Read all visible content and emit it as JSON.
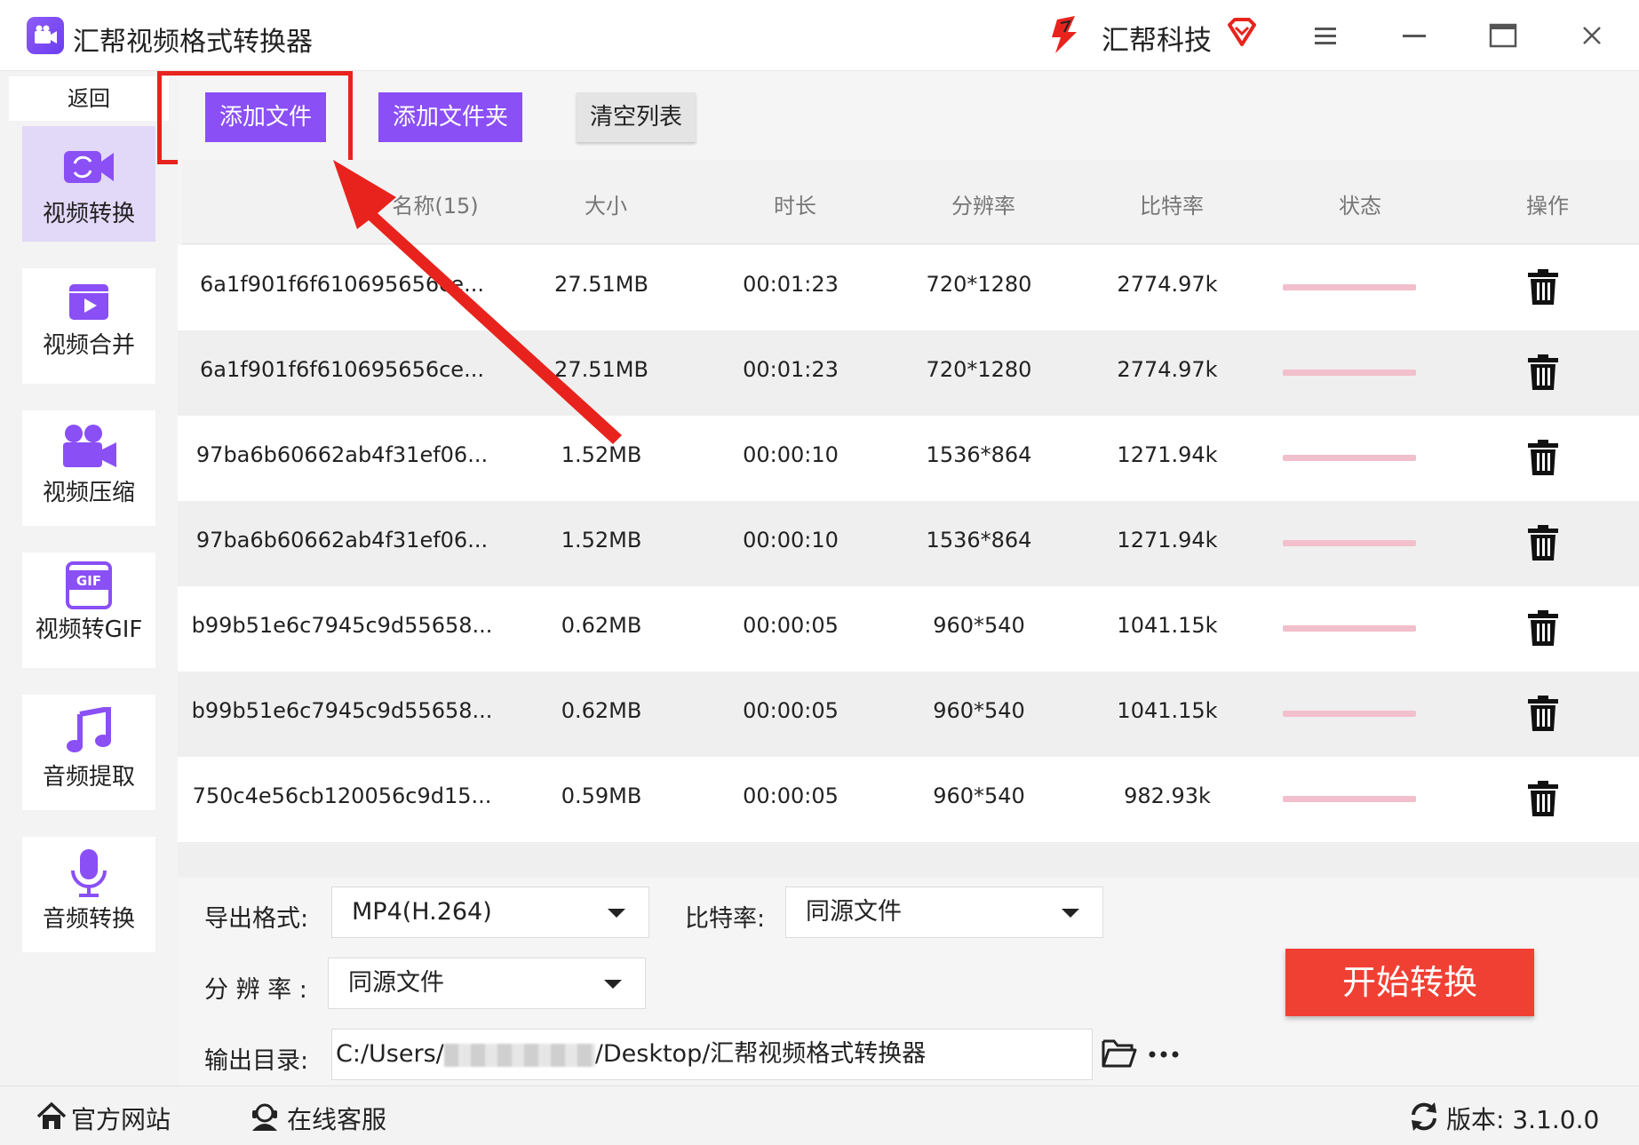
{
  "app": {
    "title": "汇帮视频格式转换器",
    "brand": "汇帮科技"
  },
  "sidebar": {
    "back": "返回",
    "items": [
      {
        "label": "视频转换",
        "icon": "video-convert-icon",
        "active": true
      },
      {
        "label": "视频合并",
        "icon": "video-merge-icon"
      },
      {
        "label": "视频压缩",
        "icon": "video-compress-icon"
      },
      {
        "label": "视频转GIF",
        "icon": "gif-icon"
      },
      {
        "label": "音频提取",
        "icon": "music-note-icon"
      },
      {
        "label": "音频转换",
        "icon": "microphone-icon"
      }
    ]
  },
  "toolbar": {
    "add_file": "添加文件",
    "add_folder": "添加文件夹",
    "clear_list": "清空列表"
  },
  "table": {
    "headers": [
      "名称(15)",
      "大小",
      "时长",
      "分辨率",
      "比特率",
      "状态",
      "操作"
    ],
    "rows": [
      {
        "name": "6a1f901f6f610695656ce...",
        "size": "27.51MB",
        "duration": "00:01:23",
        "resolution": "720*1280",
        "bitrate": "2774.97k"
      },
      {
        "name": "6a1f901f6f610695656ce...",
        "size": "27.51MB",
        "duration": "00:01:23",
        "resolution": "720*1280",
        "bitrate": "2774.97k"
      },
      {
        "name": "97ba6b60662ab4f31ef06...",
        "size": "1.52MB",
        "duration": "00:00:10",
        "resolution": "1536*864",
        "bitrate": "1271.94k"
      },
      {
        "name": "97ba6b60662ab4f31ef06...",
        "size": "1.52MB",
        "duration": "00:00:10",
        "resolution": "1536*864",
        "bitrate": "1271.94k"
      },
      {
        "name": "b99b51e6c7945c9d55658...",
        "size": "0.62MB",
        "duration": "00:00:05",
        "resolution": "960*540",
        "bitrate": "1041.15k"
      },
      {
        "name": "b99b51e6c7945c9d55658...",
        "size": "0.62MB",
        "duration": "00:00:05",
        "resolution": "960*540",
        "bitrate": "1041.15k"
      },
      {
        "name": "750c4e56cb120056c9d15...",
        "size": "0.59MB",
        "duration": "00:00:05",
        "resolution": "960*540",
        "bitrate": "982.93k"
      }
    ]
  },
  "settings": {
    "format_label": "导出格式:",
    "format_value": "MP4(H.264)",
    "bitrate_label": "比特率:",
    "bitrate_value": "同源文件",
    "resolution_label": "分 辨 率 :",
    "resolution_value": "同源文件",
    "output_label": "输出目录:",
    "output_prefix": "C:/Users/",
    "output_suffix": "/Desktop/汇帮视频格式转换器",
    "start": "开始转换"
  },
  "footer": {
    "website": "官方网站",
    "support": "在线客服",
    "version": "版本: 3.1.0.0"
  },
  "colors": {
    "accent": "#8a4ff5",
    "start_button": "#f04034",
    "highlight": "#e8231d",
    "status_bar": "#f2bfcc"
  }
}
